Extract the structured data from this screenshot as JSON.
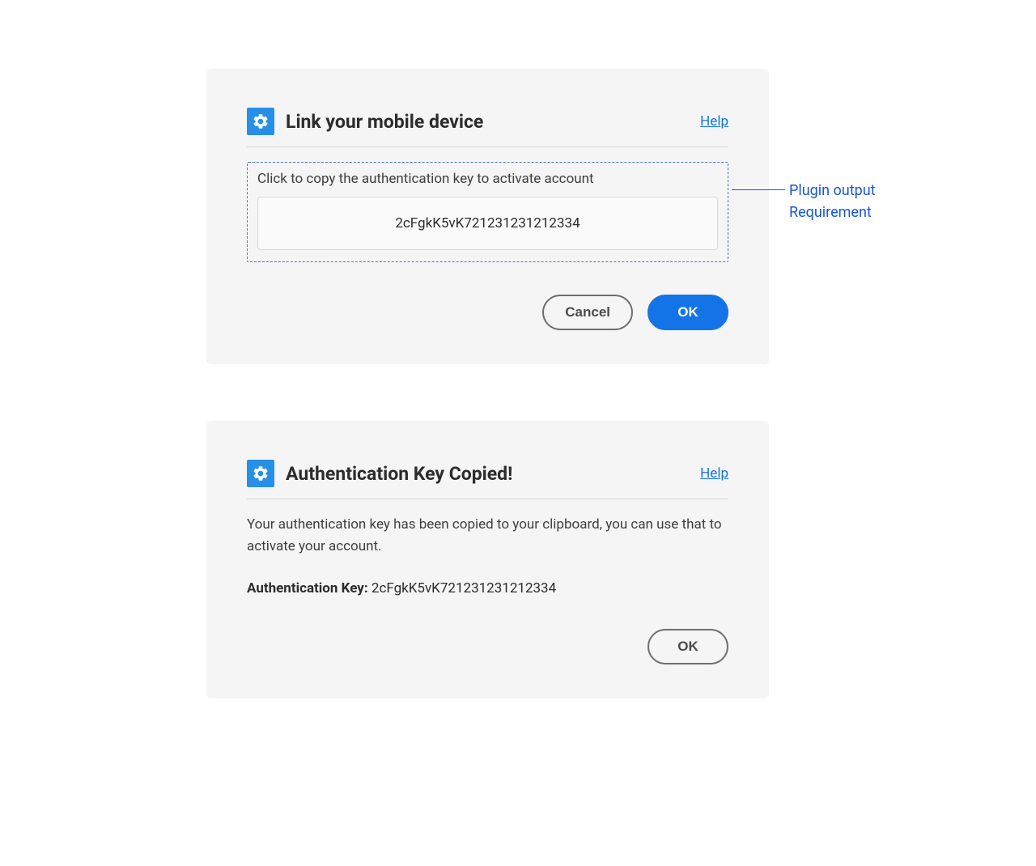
{
  "dialog1": {
    "title": "Link your mobile device",
    "help_label": "Help",
    "instruction": "Click to copy the authentication key to activate account",
    "auth_key": "2cFgkK5vK721231231212334",
    "cancel_label": "Cancel",
    "ok_label": "OK"
  },
  "dialog2": {
    "title": "Authentication Key Copied!",
    "help_label": "Help",
    "body": "Your authentication key has been copied to your clipboard, you can use that to activate your account.",
    "key_label": "Authentication Key: ",
    "auth_key": "2cFgkK5vK721231231212334",
    "ok_label": "OK"
  },
  "annotation": {
    "line1": "Plugin output",
    "line2": "Requirement"
  }
}
